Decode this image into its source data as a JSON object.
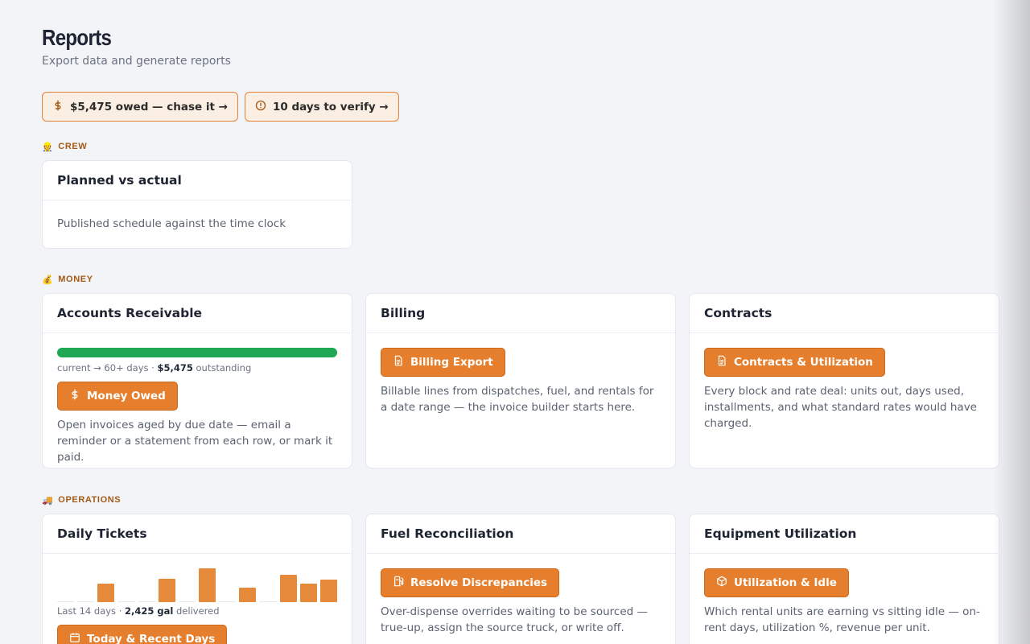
{
  "header": {
    "title": "Reports",
    "subtitle": "Export data and generate reports"
  },
  "alerts": [
    {
      "icon": "dollar-icon",
      "label": "$5,475 owed — chase it →"
    },
    {
      "icon": "alert-circle-icon",
      "label": "10 days to verify →"
    }
  ],
  "sections": {
    "crew": {
      "emoji": "👷",
      "label": "CREW",
      "cards": {
        "planned": {
          "title": "Planned vs actual",
          "description": "Published schedule against the time clock"
        }
      }
    },
    "money": {
      "emoji": "💰",
      "label": "MONEY",
      "cards": {
        "ar": {
          "title": "Accounts Receivable",
          "aging_current_fraction": 1.0,
          "meta_prefix": "current → 60+ days · ",
          "meta_amount": "$5,475",
          "meta_suffix": " outstanding",
          "button": "Money Owed",
          "description": "Open invoices aged by due date — email a reminder or a statement from each row, or mark it paid."
        },
        "billing": {
          "title": "Billing",
          "button": "Billing Export",
          "description": "Billable lines from dispatches, fuel, and rentals for a date range — the invoice builder starts here."
        },
        "contracts": {
          "title": "Contracts",
          "button": "Contracts & Utilization",
          "description": "Every block and rate deal: units out, days used, installments, and what standard rates would have charged."
        }
      }
    },
    "operations": {
      "emoji": "🚚",
      "label": "OPERATIONS",
      "cards": {
        "tickets": {
          "title": "Daily Tickets",
          "sparkline": [
            0,
            0,
            22,
            0,
            0,
            28,
            0,
            40,
            0,
            17,
            0,
            32,
            22,
            27
          ],
          "meta_prefix": "Last 14 days · ",
          "meta_amount": "2,425 gal",
          "meta_suffix": " delivered",
          "button": "Today & Recent Days"
        },
        "fuel": {
          "title": "Fuel Reconciliation",
          "button": "Resolve Discrepancies",
          "description": "Over-dispense overrides waiting to be sourced — true-up, assign the source truck, or write off."
        },
        "equipment": {
          "title": "Equipment Utilization",
          "button": "Utilization & Idle",
          "description": "Which rental units are earning vs sitting idle — on-rent days, utilization %, revenue per unit."
        }
      }
    }
  },
  "colors": {
    "accent": "#e57f2d",
    "alert_bg": "#fbeee3",
    "section_label": "#a35a16",
    "ar_current": "#1fa854"
  }
}
